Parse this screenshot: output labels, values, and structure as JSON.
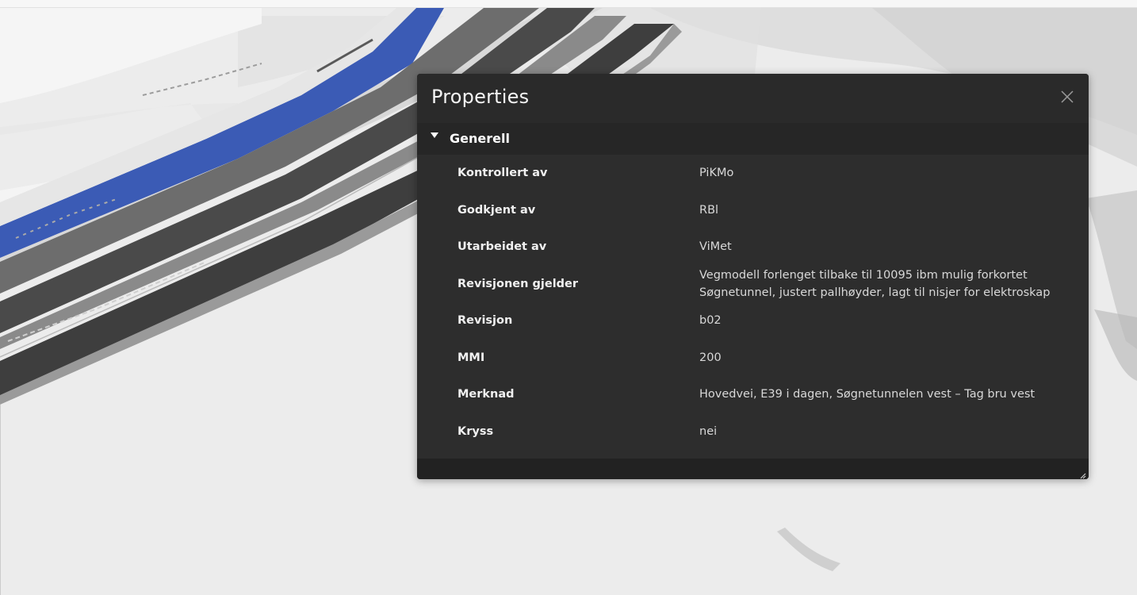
{
  "panel": {
    "title": "Properties",
    "close_icon": "close-icon",
    "section": {
      "label": "Generell",
      "expanded": true,
      "icon": "caret-down-icon"
    },
    "rows": [
      {
        "key": "Kontrollert av",
        "value": "PiKMo"
      },
      {
        "key": "Godkjent av",
        "value": "RBl"
      },
      {
        "key": "Utarbeidet av",
        "value": "ViMet"
      },
      {
        "key": "Revisjonen gjelder",
        "value": "Vegmodell forlenget tilbake til 10095 ibm mulig forkortet Søgnetunnel, justert pallhøyder, lagt til nisjer for elektroskap"
      },
      {
        "key": "Revisjon",
        "value": "b02"
      },
      {
        "key": "MMI",
        "value": "200"
      },
      {
        "key": "Merknad",
        "value": "Hovedvei, E39 i dagen, Søgnetunnelen vest – Tag bru vest"
      },
      {
        "key": "Kryss",
        "value": "nei"
      }
    ],
    "resize_icon": "resize-grip-icon"
  },
  "colors": {
    "panel_bg": "#2d2d2d",
    "road_blue": "#3b5bb5",
    "viewport_bg": "#eeeeee"
  }
}
